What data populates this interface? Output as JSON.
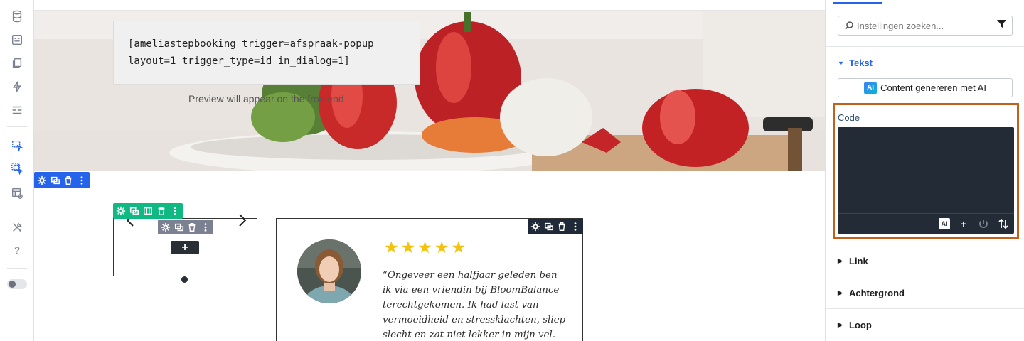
{
  "canvas": {
    "code_card_lines": [
      "[ameliastepbooking trigger=afspraak-popup",
      "layout=1 trigger_type=id in_dialog=1]"
    ],
    "preview_text": "Preview will appear on the frontend",
    "carousel_add_label": "+",
    "testimonial": {
      "rating": 5,
      "quote": "“Ongeveer een halfjaar geleden ben ik via een vriendin bij BloomBalance terechtgekomen. Ik had last van vermoeidheid en stressklachten, sliep slecht en zat niet lekker in mijn vel. Door een"
    }
  },
  "panel": {
    "search_placeholder": "Instellingen zoeken...",
    "sections": {
      "tekst": "Tekst",
      "link": "Link",
      "achtergrond": "Achtergrond",
      "loop": "Loop"
    },
    "ai_button_label": "Content genereren met AI",
    "ai_badge": "AI",
    "code_label": "Code",
    "code_value": "",
    "footer_ai": "AI",
    "footer_plus": "+"
  },
  "colors": {
    "accent_blue": "#2563eb",
    "toolbar_green": "#10b981",
    "highlight_orange": "#c2611c",
    "editor_bg": "#222b36"
  }
}
